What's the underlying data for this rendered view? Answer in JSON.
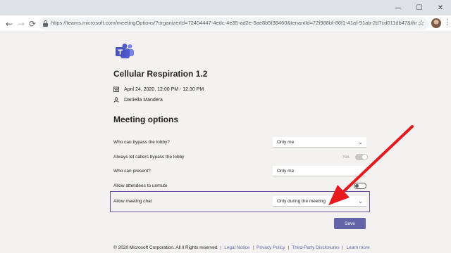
{
  "browser": {
    "url": "https://teams.microsoft.com/meetingOptions/?organizerId=72404447-4edc-4e35-ad2e-5ae8b5f38460&tenantId=72f988bf-86f1-41af-91ab-2d7cd011db47&threadId=19_meeting...",
    "window_controls": {
      "minimize": "—",
      "maximize": "☐",
      "close": "✕"
    },
    "nav": {
      "back": "←",
      "forward": "→",
      "reload": "⟳"
    }
  },
  "meeting": {
    "title": "Cellular Respiration 1.2",
    "datetime": "April 24, 2020, 12:00 PM - 12:30 PM",
    "organizer": "Daniella Mandera"
  },
  "options": {
    "section_title": "Meeting options",
    "bypass_lobby": {
      "label": "Who can bypass the lobby?",
      "value": "Only me"
    },
    "callers_bypass": {
      "label": "Always let callers bypass the lobby",
      "state": "Yes"
    },
    "who_present": {
      "label": "Who can present?",
      "value": "Only me"
    },
    "attendees_unmute": {
      "label": "Allow attendees to unmute"
    },
    "meeting_chat": {
      "label": "Allow meeting chat",
      "value": "Only during the meeting"
    }
  },
  "save_label": "Save",
  "footer": {
    "copyright": "© 2020 Microsoft Corporation. All ll Rights reserved",
    "links": [
      "Legal Notice",
      "Privacy Policy",
      "Third-Party Disclosures",
      "Learn more"
    ]
  },
  "colors": {
    "teams_purple": "#6264a7",
    "highlight": "#6b4f9e",
    "arrow": "#e8191c"
  }
}
